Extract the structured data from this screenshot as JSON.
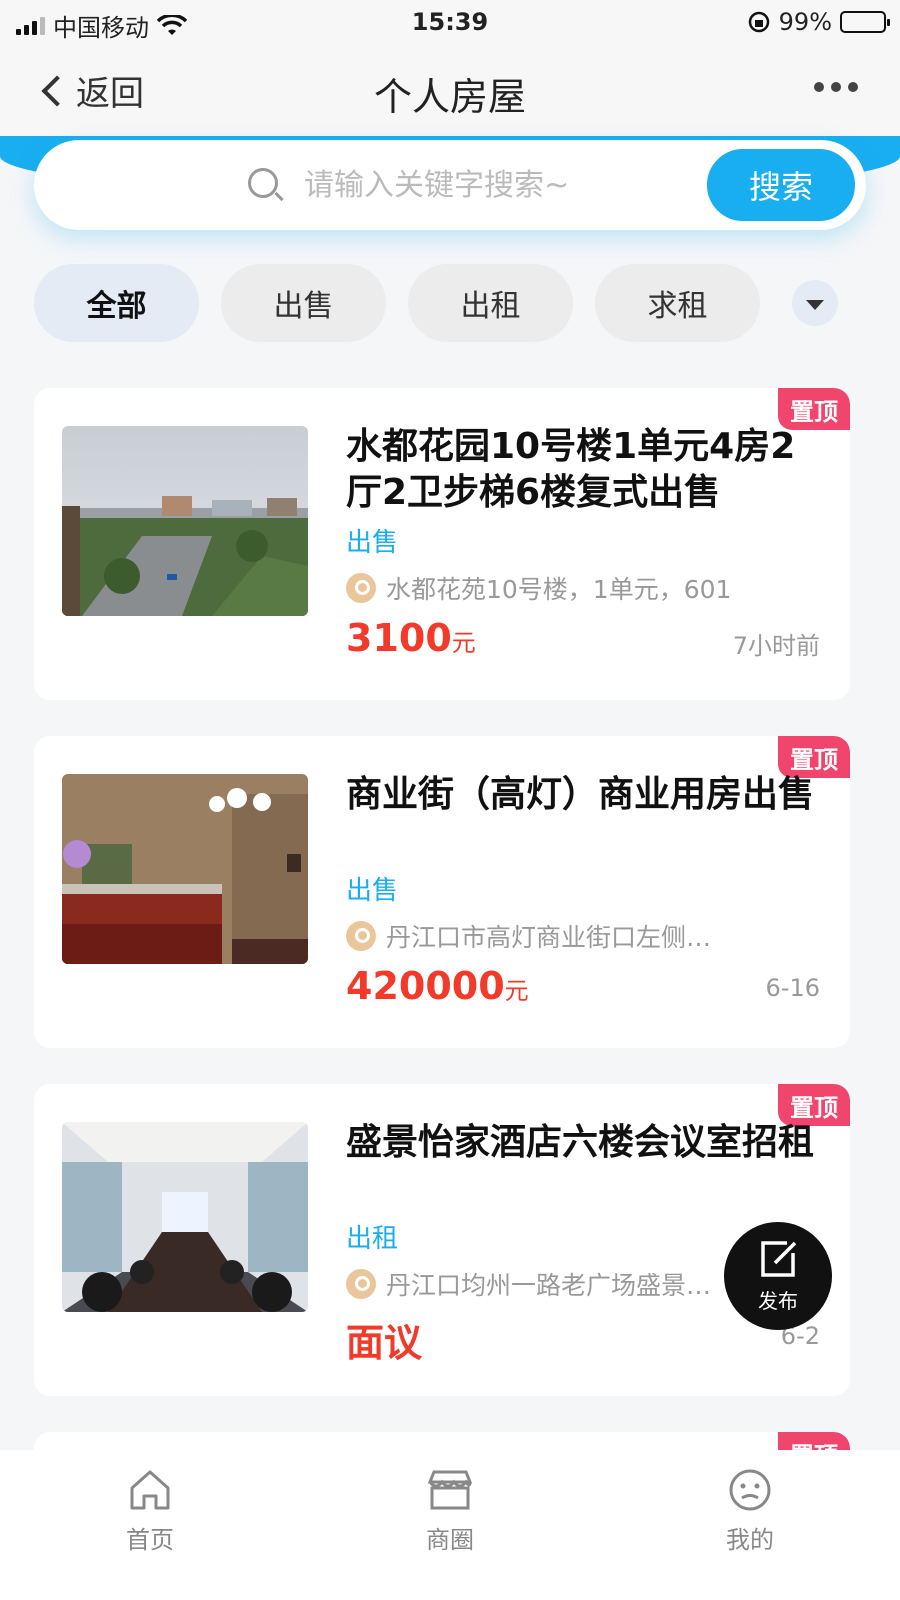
{
  "status": {
    "carrier": "中国移动",
    "time": "15:39",
    "battery": "99%"
  },
  "nav": {
    "back_label": "返回",
    "title": "个人房屋"
  },
  "search": {
    "placeholder": "请输入关键字搜索~",
    "button_label": "搜索"
  },
  "tabs": [
    {
      "label": "全部",
      "active": true
    },
    {
      "label": "出售",
      "active": false
    },
    {
      "label": "出租",
      "active": false
    },
    {
      "label": "求租",
      "active": false
    }
  ],
  "listings": [
    {
      "badge": "置顶",
      "title": "水都花园10号楼1单元4房2厅2卫步梯6楼复式出售",
      "type": "出售",
      "address": "水都花苑10号楼，1单元，601",
      "price": "3100",
      "price_unit": "元",
      "time": "7小时前"
    },
    {
      "badge": "置顶",
      "title": "商业街（高灯）商业用房出售",
      "type": "出售",
      "address": "丹江口市高灯商业街口左侧…",
      "price": "420000",
      "price_unit": "元",
      "time": "6-16"
    },
    {
      "badge": "置顶",
      "title": "盛景怡家酒店六楼会议室招租",
      "type": "出租",
      "address": "丹江口均州一路老广场盛景…",
      "price": "面议",
      "price_unit": "",
      "time": "6-2"
    },
    {
      "badge": "置顶"
    }
  ],
  "fab": {
    "label": "发布"
  },
  "tabbar": [
    {
      "label": "首页",
      "icon": "home-icon"
    },
    {
      "label": "商圈",
      "icon": "store-icon"
    },
    {
      "label": "我的",
      "icon": "profile-icon"
    }
  ],
  "colors": {
    "accent": "#18aef0",
    "badge": "#f0466e",
    "price": "#f23a2a"
  }
}
